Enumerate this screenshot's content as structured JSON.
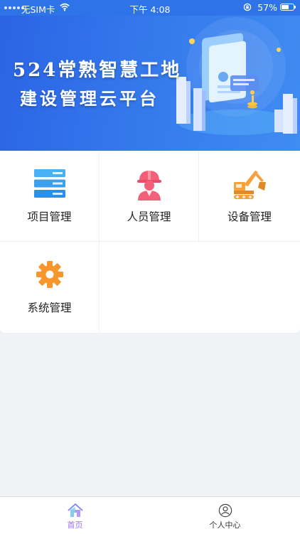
{
  "status_bar": {
    "carrier": "无SIM卡",
    "time": "下午 4:08",
    "battery": "57%"
  },
  "banner": {
    "title_line1": "524常熟智慧工地",
    "title_line2": "建设管理云平台"
  },
  "grid": {
    "items": [
      {
        "label": "项目管理",
        "icon": "list-icon"
      },
      {
        "label": "人员管理",
        "icon": "worker-icon"
      },
      {
        "label": "设备管理",
        "icon": "excavator-icon"
      },
      {
        "label": "系统管理",
        "icon": "gear-icon"
      }
    ]
  },
  "tabbar": {
    "tabs": [
      {
        "label": "首页",
        "icon": "home-icon",
        "active": true
      },
      {
        "label": "个人中心",
        "icon": "user-icon",
        "active": false
      }
    ]
  },
  "colors": {
    "banner_blue": "#2f73e8",
    "project_icon": "#3aa0f0",
    "worker_icon": "#f2607a",
    "excavator_icon": "#f5a13c",
    "gear_icon": "#f7962c",
    "tab_active": "#a074e6"
  }
}
